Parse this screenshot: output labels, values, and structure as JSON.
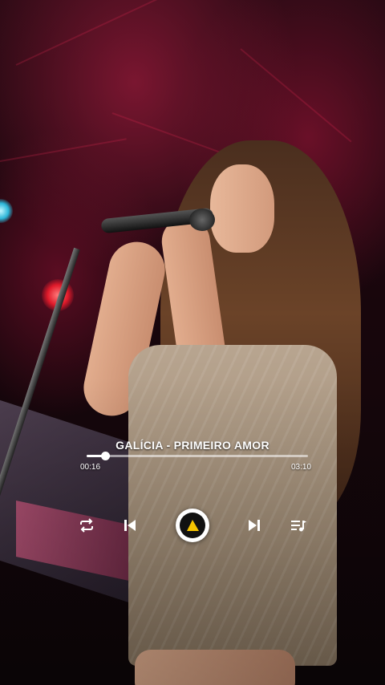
{
  "player": {
    "title": "GALÍCIA - PRIMEIRO AMOR",
    "current_time": "00:16",
    "total_time": "03:10",
    "progress": 0.085
  },
  "controls": {
    "repeat_icon": "repeat-icon",
    "previous_icon": "skip-previous-icon",
    "play_icon": "play-icon",
    "next_icon": "skip-next-icon",
    "queue_icon": "playlist-queue-icon"
  },
  "colors": {
    "accent": "#f5c400",
    "text": "#ffffff"
  }
}
